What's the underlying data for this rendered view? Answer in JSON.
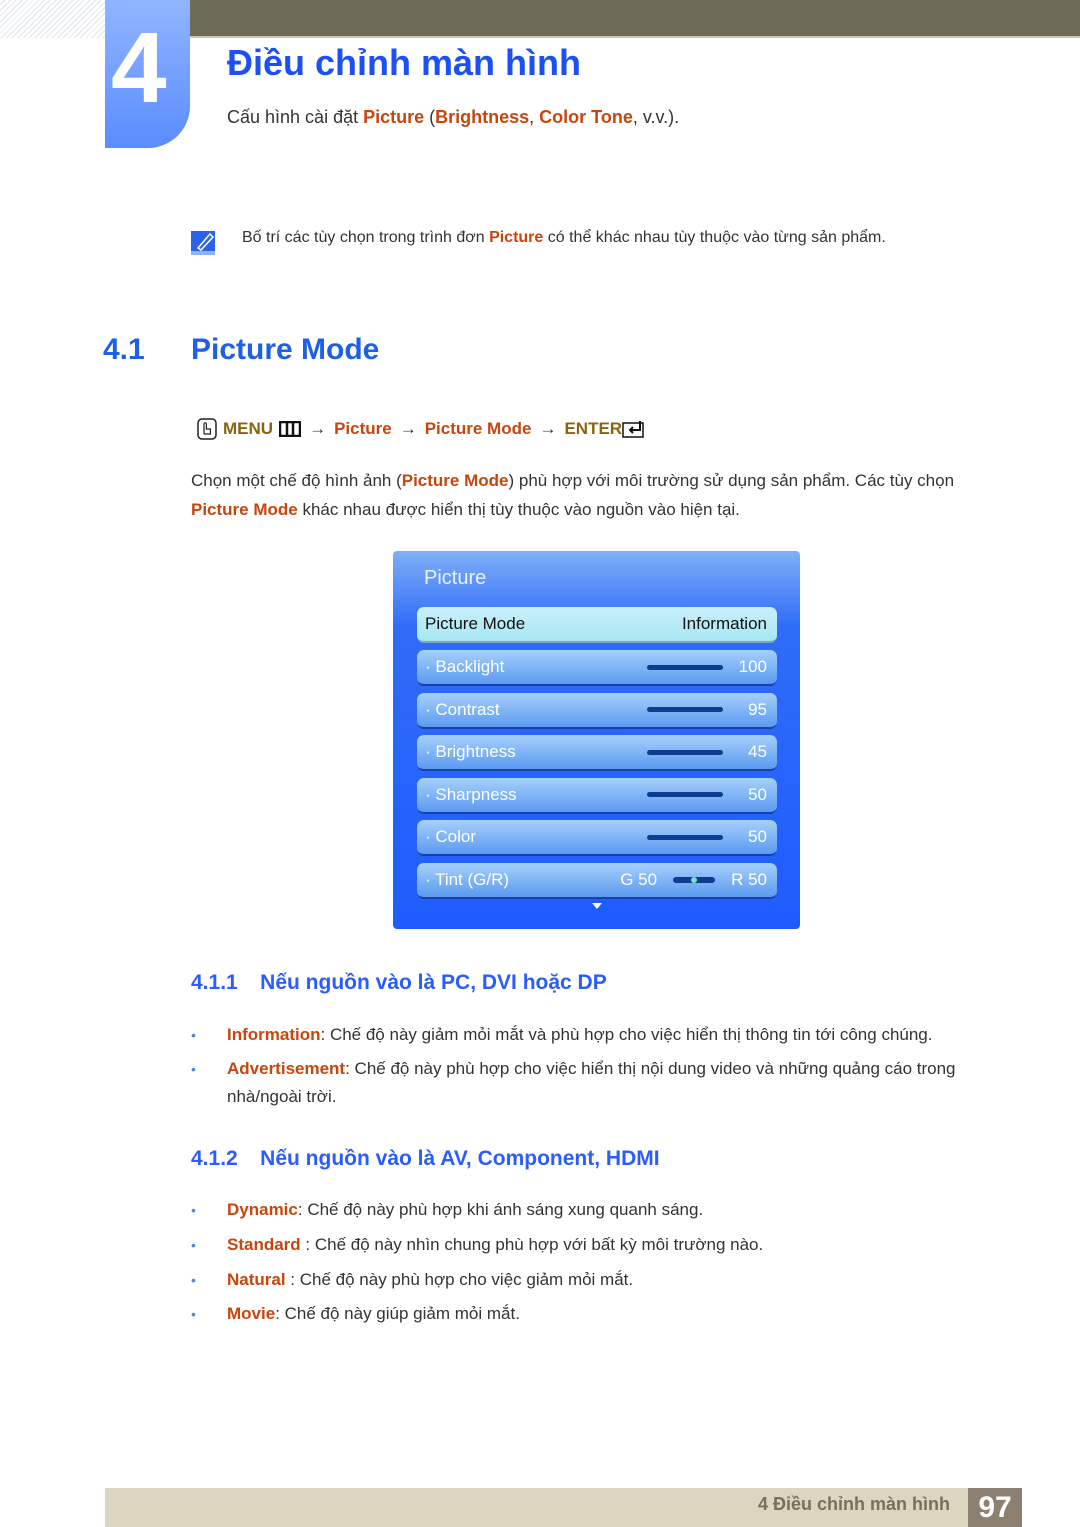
{
  "chapter": {
    "number": "4",
    "title": "Điều chỉnh màn hình",
    "subtitle": [
      {
        "t": "Cấu hình cài đặt "
      },
      {
        "t": "Picture",
        "hl": true
      },
      {
        "t": " ("
      },
      {
        "t": "Brightness",
        "hl": true
      },
      {
        "t": ", "
      },
      {
        "t": "Color Tone",
        "hl": true
      },
      {
        "t": ", v.v.)."
      }
    ]
  },
  "note": [
    {
      "t": "Bố trí các tùy chọn trong trình đơn "
    },
    {
      "t": "Picture",
      "hl": true
    },
    {
      "t": " có thể khác nhau tùy thuộc vào từng sản phẩm."
    }
  ],
  "section": {
    "number": "4.1",
    "title": "Picture Mode"
  },
  "menu_path": {
    "menu": "MENU",
    "step1": "Picture",
    "step2": "Picture Mode",
    "enter": "ENTER",
    "arrow": "→"
  },
  "intro": [
    {
      "t": "Chọn một chế độ hình ảnh ("
    },
    {
      "t": "Picture Mode",
      "hl": true
    },
    {
      "t": ") phù hợp với môi trường sử dụng sản phẩm. Các tùy chọn "
    },
    {
      "t": "Picture Mode",
      "hl": true
    },
    {
      "t": " khác nhau được hiển thị tùy thuộc vào nguồn vào hiện tại."
    }
  ],
  "osd": {
    "title": "Picture",
    "selected": {
      "label": "Picture Mode",
      "value": "Information"
    },
    "rows": [
      {
        "label": "· Backlight",
        "value": "100",
        "level": 100
      },
      {
        "label": "· Contrast",
        "value": "95",
        "level": 95
      },
      {
        "label": "· Brightness",
        "value": "45",
        "level": 45
      },
      {
        "label": "· Sharpness",
        "value": "50",
        "level": 50
      },
      {
        "label": "· Color",
        "value": "50",
        "level": 50
      }
    ],
    "tint": {
      "label": "· Tint (G/R)",
      "g": "G 50",
      "r": "R 50"
    },
    "colors": {
      "accent": "#1e5cff",
      "fill": "#74e3c8",
      "track": "#103c90"
    }
  },
  "sub1": {
    "number": "4.1.1",
    "title": "Nếu nguồn vào là PC, DVI hoặc DP",
    "items": [
      [
        {
          "t": "Information",
          "hl": true
        },
        {
          "t": ": Chế độ này giảm mỏi mắt và phù hợp cho việc hiển thị thông tin tới công chúng."
        }
      ],
      [
        {
          "t": "Advertisement",
          "hl": true
        },
        {
          "t": ": Chế độ này phù hợp cho việc hiển thị nội dung video và những quảng cáo trong nhà/ngoài trời."
        }
      ]
    ]
  },
  "sub2": {
    "number": "4.1.2",
    "title": "Nếu nguồn vào là AV, Component, HDMI",
    "items": [
      [
        {
          "t": "Dynamic",
          "hl": true
        },
        {
          "t": ": Chế độ này phù hợp khi ánh sáng xung quanh sáng."
        }
      ],
      [
        {
          "t": "Standard",
          "hl": true
        },
        {
          "t": " : Chế độ này nhìn chung phù hợp với bất kỳ môi trường nào."
        }
      ],
      [
        {
          "t": "Natural",
          "hl": true
        },
        {
          "t": " : Chế độ này phù hợp cho việc giảm mỏi mắt."
        }
      ],
      [
        {
          "t": "Movie",
          "hl": true
        },
        {
          "t": ": Chế độ này giúp giảm mỏi mắt."
        }
      ]
    ]
  },
  "footer": {
    "chapter": "4 Điều chỉnh màn hình",
    "page": "97"
  },
  "colors": {
    "heading_blue": "#1f5fe8",
    "highlight": "#c8460e",
    "menu_olive": "#8a6410",
    "topbar": "#6d6b58",
    "footer": "#dcd5bf"
  }
}
